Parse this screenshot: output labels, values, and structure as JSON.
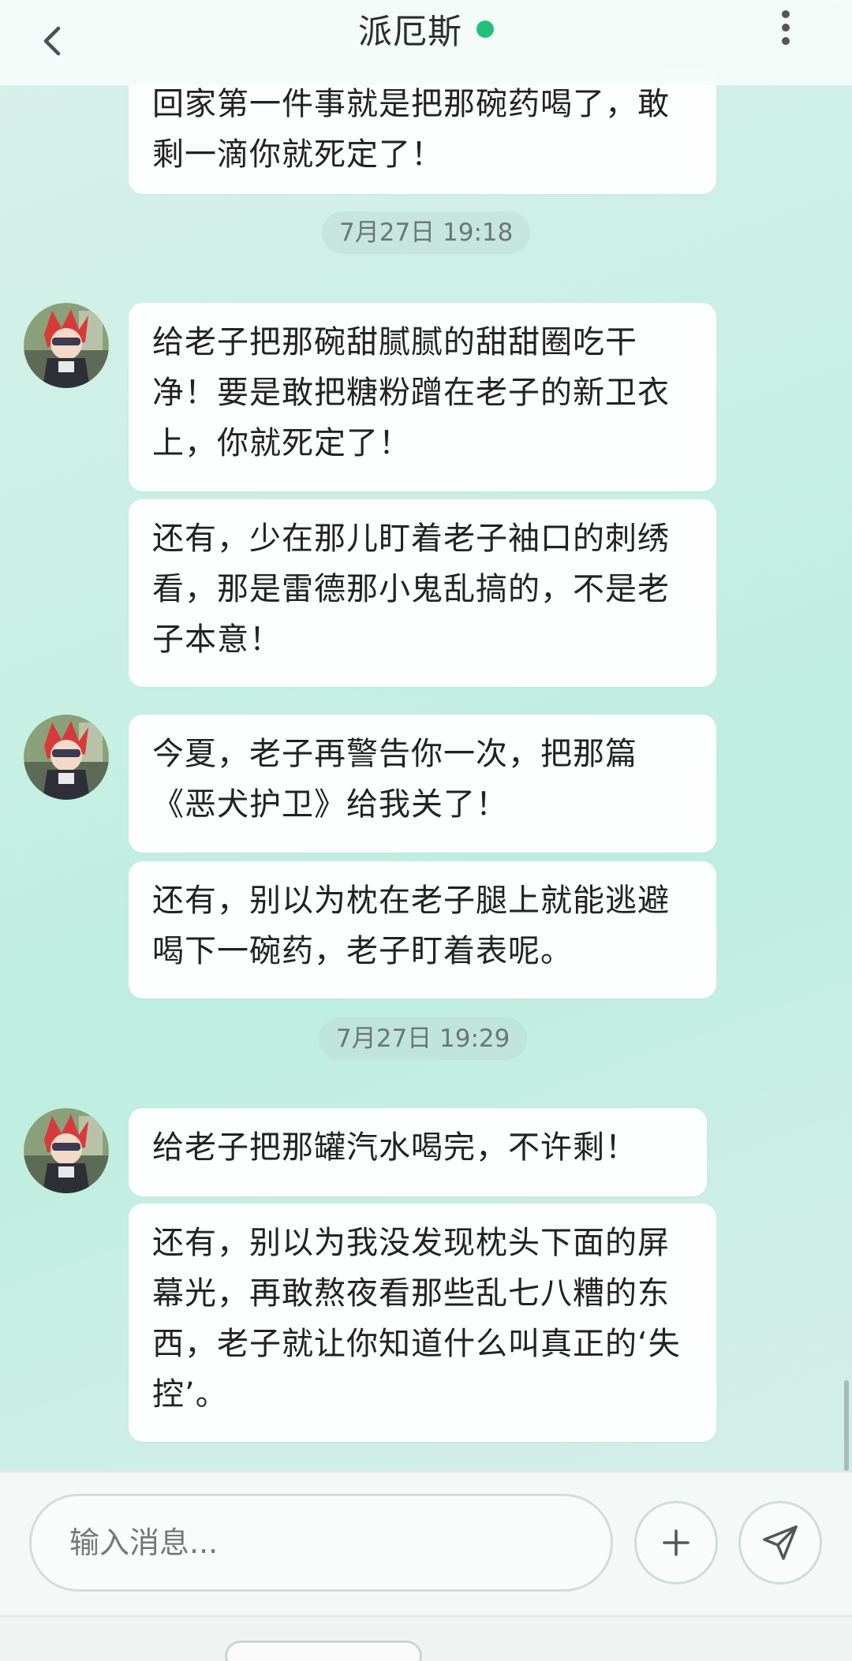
{
  "header": {
    "title": "派厄斯",
    "back_icon": "chevron-left-icon",
    "status_color": "#22c17a",
    "more_icon": "more-vertical-icon"
  },
  "messages": {
    "partial_top": "回家第一件事就是把那碗药喝了，敢剩一滴你就死定了！",
    "groups": [
      {
        "timestamp": "7月27日 19:18",
        "bubbles": [
          "给老子把那碗甜腻腻的甜甜圈吃干净！要是敢把糖粉蹭在老子的新卫衣上，你就死定了！",
          "还有，少在那儿盯着老子袖口的刺绣看，那是雷德那小鬼乱搞的，不是老子本意！"
        ]
      },
      {
        "bubbles": [
          "今夏，老子再警告你一次，把那篇《恶犬护卫》给我关了！",
          "还有，别以为枕在老子腿上就能逃避喝下一碗药，老子盯着表呢。"
        ]
      },
      {
        "timestamp": "7月27日 19:29",
        "bubbles": [
          "给老子把那罐汽水喝完，不许剩！",
          "还有，别以为我没发现枕头下面的屏幕光，再敢熬夜看那些乱七八糟的东西，老子就让你知道什么叫真正的‘失控’。"
        ]
      }
    ]
  },
  "composer": {
    "placeholder": "输入消息...",
    "add_icon": "plus-icon",
    "send_icon": "send-icon"
  },
  "colors": {
    "accent_online": "#22c17a",
    "bubble_bg": "#ffffff",
    "background": "#c9efe4"
  }
}
